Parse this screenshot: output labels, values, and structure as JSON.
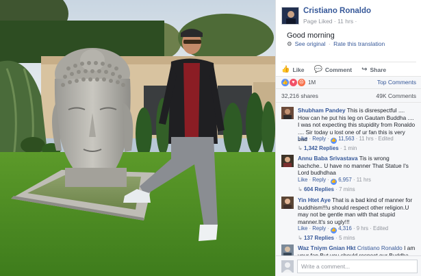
{
  "post": {
    "author": "Cristiano Ronaldo",
    "meta": "Page Liked · 11 hrs ·",
    "text": "Good morning",
    "see_original": "See original",
    "rate_translation": "Rate this translation"
  },
  "actions": {
    "like": "Like",
    "comment": "Comment",
    "share": "Share"
  },
  "reactions": {
    "count": "1M",
    "top_comments": "Top Comments"
  },
  "stats": {
    "shares": "32,216 shares",
    "comments": "49K Comments"
  },
  "comments": [
    {
      "name": "Shubham Pandey",
      "text": "This is disrespectful .... How can he put his leg on Gautam Buddha .... I was not expecting this stupidity from Ronaldo .... Sir today u lost one of ur fan this is very bad",
      "like": "Like",
      "reply": "Reply",
      "likes": "11,563",
      "time": "11 hrs",
      "edited": "Edited",
      "replies": "1,342 Replies",
      "replies_time": "1 min"
    },
    {
      "name": "Annu Baba Srivastava",
      "text": "Tis is wrong bachche.. U have no manner That Statue I's Lord budhdhaa",
      "like": "Like",
      "reply": "Reply",
      "likes": "6,957",
      "time": "11 hrs",
      "edited": "",
      "replies": "604 Replies",
      "replies_time": "7 mins"
    },
    {
      "name": "Yin Htet Aye",
      "text": "That is a bad kind of manner for buddhism!!!u should respect other religion.U may not be gentle man with that stupid manner.It's so ugly!!!",
      "like": "Like",
      "reply": "Reply",
      "likes": "4,316",
      "time": "9 hrs",
      "edited": "Edited",
      "replies": "137 Replies",
      "replies_time": "5 mins"
    },
    {
      "name": "Waz Tniym Gnian Hkt",
      "mention": "Cristiano Ronaldo",
      "text": "I am your fan But you should respect our Buddha However"
    }
  ],
  "composer": {
    "placeholder": "Write a comment..."
  },
  "colors": {
    "link_blue": "#365899",
    "grey_text": "#90949c",
    "panel_bg": "#f6f7f9"
  },
  "icons": {
    "settings": "gear-icon",
    "like": "thumbs-up-icon",
    "comment": "speech-bubble-icon",
    "share": "share-arrow-icon",
    "reaction_like": "like-reaction-icon",
    "reaction_love": "love-reaction-icon",
    "reaction_angry": "angry-reaction-icon",
    "camera": "camera-icon",
    "emoji": "smiley-icon"
  }
}
